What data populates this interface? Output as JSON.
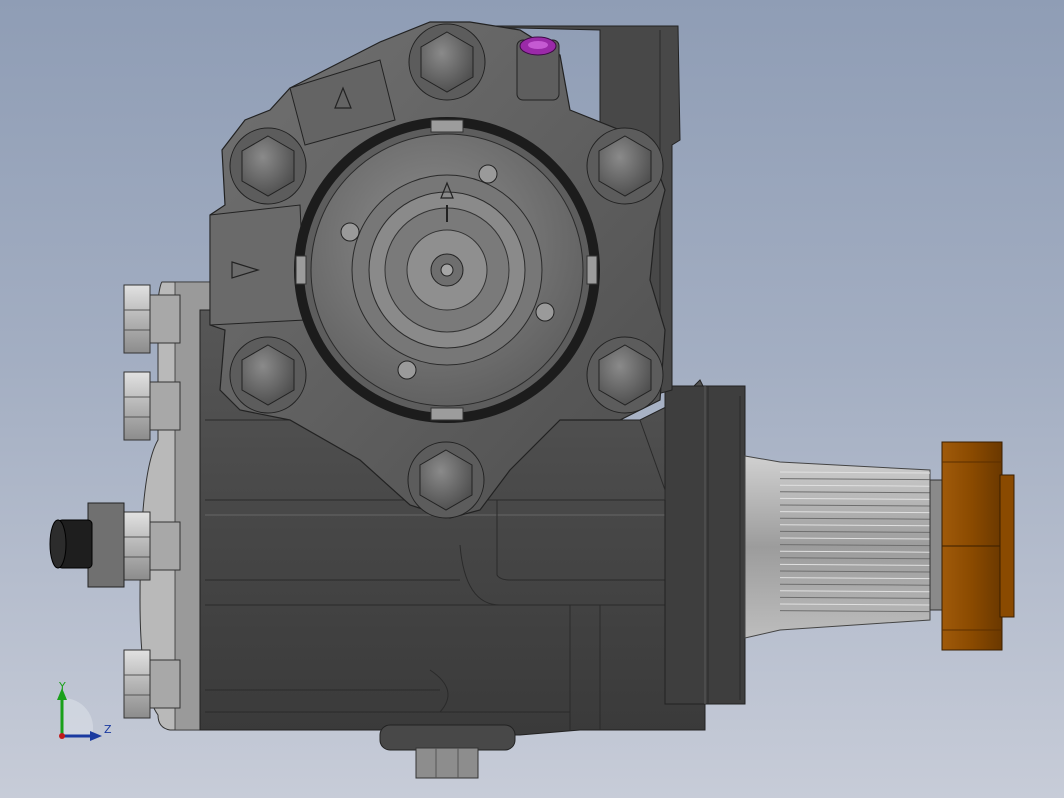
{
  "viewport": {
    "background_top": "#8f9db5",
    "background_bottom": "#c7ccd8"
  },
  "model": {
    "housing_color": "#4a4a4a",
    "flange_color": "#5e5e5e",
    "nut_color": "#8a4a00",
    "marker_color": "#9a2aa8",
    "fitting_color": "#c8c8c8"
  },
  "triad": {
    "y_label": "Y",
    "z_label": "Z",
    "y_color": "#1aa01a",
    "z_color": "#1a3aa0"
  }
}
